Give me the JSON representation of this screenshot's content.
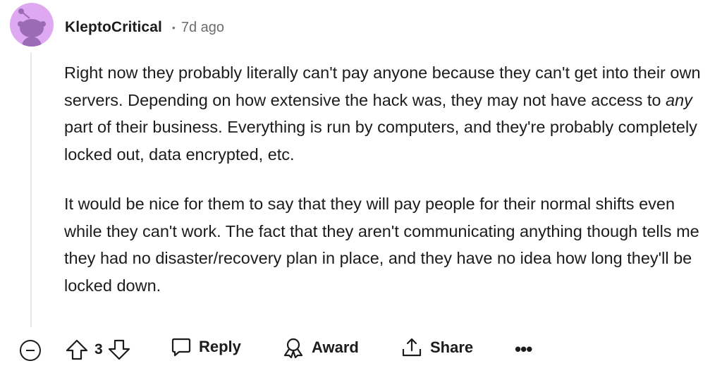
{
  "comment": {
    "author": "KleptoCritical",
    "timestamp": "7d ago",
    "paragraph1_a": "Right now they probably literally can't pay anyone because they can't get into their own servers. Depending on how extensive the hack was, they may not have access to ",
    "paragraph1_em": "any",
    "paragraph1_b": " part of their business. Everything is run by computers, and they're probably completely locked out, data encrypted, etc.",
    "paragraph2": "It would be nice for them to say that they will pay people for their normal shifts even while they can't work. The fact that they aren't communicating anything though tells me they had no disaster/recovery plan in place, and they have no idea how long they'll be locked down."
  },
  "actions": {
    "vote_count": "3",
    "reply_label": "Reply",
    "award_label": "Award",
    "share_label": "Share",
    "more_label": "•••"
  },
  "colors": {
    "avatar_bg": "#dfa9f2",
    "snoo": "#9b6bb5"
  }
}
